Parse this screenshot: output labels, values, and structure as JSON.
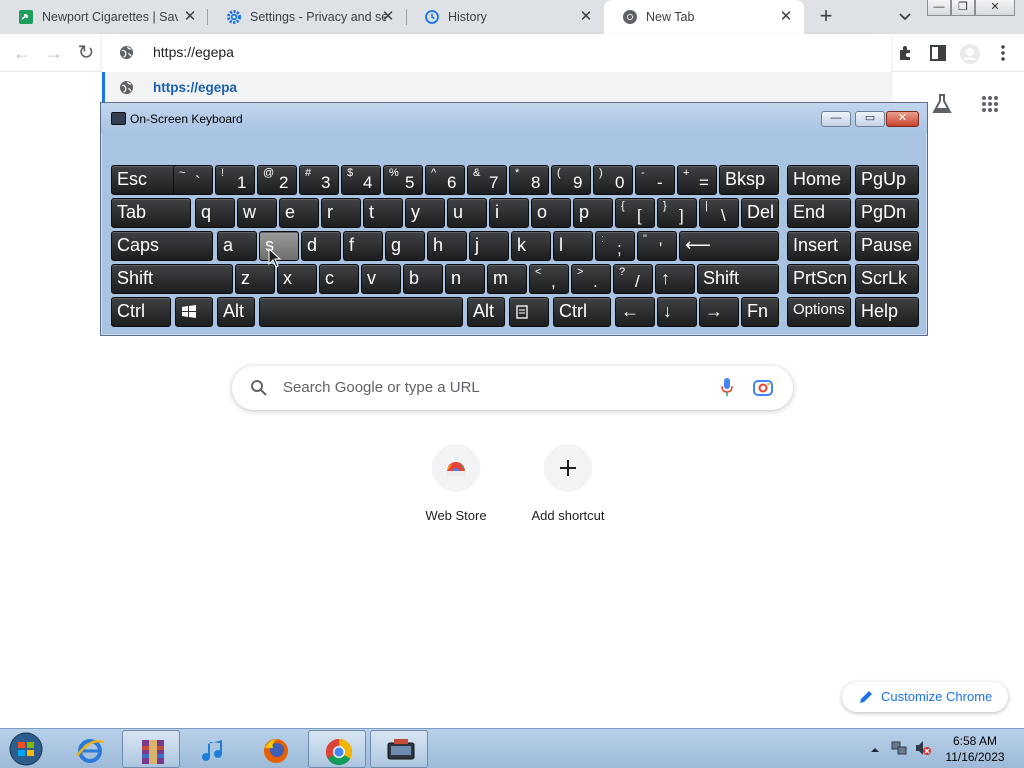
{
  "tabs": [
    {
      "title": "Newport Cigarettes | Save",
      "icon": "newport-favicon",
      "close": "✕"
    },
    {
      "title": "Settings - Privacy and sec",
      "icon": "settings-gear-icon",
      "close": "✕"
    },
    {
      "title": "History",
      "icon": "history-icon",
      "close": "✕"
    },
    {
      "title": "New Tab",
      "icon": "chrome-icon",
      "close": "✕",
      "active": true
    }
  ],
  "tabstrip": {
    "new_tab": "+",
    "tab_search": "chevron-down-icon"
  },
  "window_controls": {
    "minimize": "—",
    "restore": "❐",
    "close": "✕"
  },
  "toolbar": {
    "back": "←",
    "forward": "→",
    "reload": "↻"
  },
  "omnibox": {
    "value": "https://egepa"
  },
  "suggestion": {
    "text": "https://egepa"
  },
  "osk": {
    "title": "On-Screen Keyboard",
    "controls": {
      "minimize": "—",
      "restore": "▭",
      "close": "✕"
    },
    "rows": [
      [
        {
          "label": "Esc"
        },
        {
          "shift": "~",
          "main": "`"
        },
        {
          "shift": "!",
          "main": "1"
        },
        {
          "shift": "@",
          "main": "2"
        },
        {
          "shift": "#",
          "main": "3"
        },
        {
          "shift": "$",
          "main": "4"
        },
        {
          "shift": "%",
          "main": "5"
        },
        {
          "shift": "^",
          "main": "6"
        },
        {
          "shift": "&",
          "main": "7"
        },
        {
          "shift": "*",
          "main": "8"
        },
        {
          "shift": "(",
          "main": "9"
        },
        {
          "shift": ")",
          "main": "0"
        },
        {
          "shift": "-",
          "main": "-"
        },
        {
          "shift": "+",
          "main": "="
        },
        {
          "label": "Bksp"
        },
        {
          "label": "Home"
        },
        {
          "label": "PgUp"
        }
      ],
      [
        {
          "label": "Tab"
        },
        {
          "label": "q"
        },
        {
          "label": "w"
        },
        {
          "label": "e"
        },
        {
          "label": "r"
        },
        {
          "label": "t"
        },
        {
          "label": "y"
        },
        {
          "label": "u"
        },
        {
          "label": "i"
        },
        {
          "label": "o"
        },
        {
          "label": "p"
        },
        {
          "shift": "{",
          "main": "["
        },
        {
          "shift": "}",
          "main": "]"
        },
        {
          "shift": "|",
          "main": "\\"
        },
        {
          "label": "Del"
        },
        {
          "label": "End"
        },
        {
          "label": "PgDn"
        }
      ],
      [
        {
          "label": "Caps"
        },
        {
          "label": "a"
        },
        {
          "label": "s",
          "pressed": true
        },
        {
          "label": "d"
        },
        {
          "label": "f"
        },
        {
          "label": "g"
        },
        {
          "label": "h"
        },
        {
          "label": "j"
        },
        {
          "label": "k"
        },
        {
          "label": "l"
        },
        {
          "shift": ":",
          "main": ";"
        },
        {
          "shift": "\"",
          "main": "'"
        },
        {
          "label": "⟵"
        },
        {
          "label": "Insert"
        },
        {
          "label": "Pause"
        }
      ],
      [
        {
          "label": "Shift"
        },
        {
          "label": "z"
        },
        {
          "label": "x"
        },
        {
          "label": "c"
        },
        {
          "label": "v"
        },
        {
          "label": "b"
        },
        {
          "label": "n"
        },
        {
          "label": "m"
        },
        {
          "shift": "<",
          "main": ","
        },
        {
          "shift": ">",
          "main": "."
        },
        {
          "shift": "?",
          "main": "/"
        },
        {
          "label": "↑"
        },
        {
          "label": "Shift"
        },
        {
          "label": "PrtScn"
        },
        {
          "label": "ScrLk"
        }
      ],
      [
        {
          "label": "Ctrl"
        },
        {
          "label": "windows-logo-icon",
          "icon": true
        },
        {
          "label": "Alt"
        },
        {
          "label": ""
        },
        {
          "label": "Alt"
        },
        {
          "label": "menu-icon",
          "icon": true
        },
        {
          "label": "Ctrl"
        },
        {
          "label": "←"
        },
        {
          "label": "↓"
        },
        {
          "label": "→"
        },
        {
          "label": "Fn"
        },
        {
          "label": "Options"
        },
        {
          "label": "Help"
        }
      ]
    ]
  },
  "ntp": {
    "search_placeholder": "Search Google or type a URL",
    "shortcuts": [
      {
        "label": "Web Store",
        "icon": "web-store-icon"
      },
      {
        "label": "Add shortcut",
        "icon": "plus-icon"
      }
    ],
    "customize_label": "Customize Chrome"
  },
  "taskbar": {
    "apps": [
      "start-orb",
      "internet-explorer-icon",
      "winrar-icon",
      "itunes-icon",
      "firefox-icon",
      "chrome-icon",
      "on-screen-keyboard-icon"
    ],
    "clock_time": "6:58 AM",
    "clock_date": "11/16/2023"
  },
  "colors": {
    "accent": "#1a73e8",
    "tabstrip": "#dee1e6",
    "osk_frame": "#a9c3e3",
    "taskbar": "#b9d1ea"
  }
}
